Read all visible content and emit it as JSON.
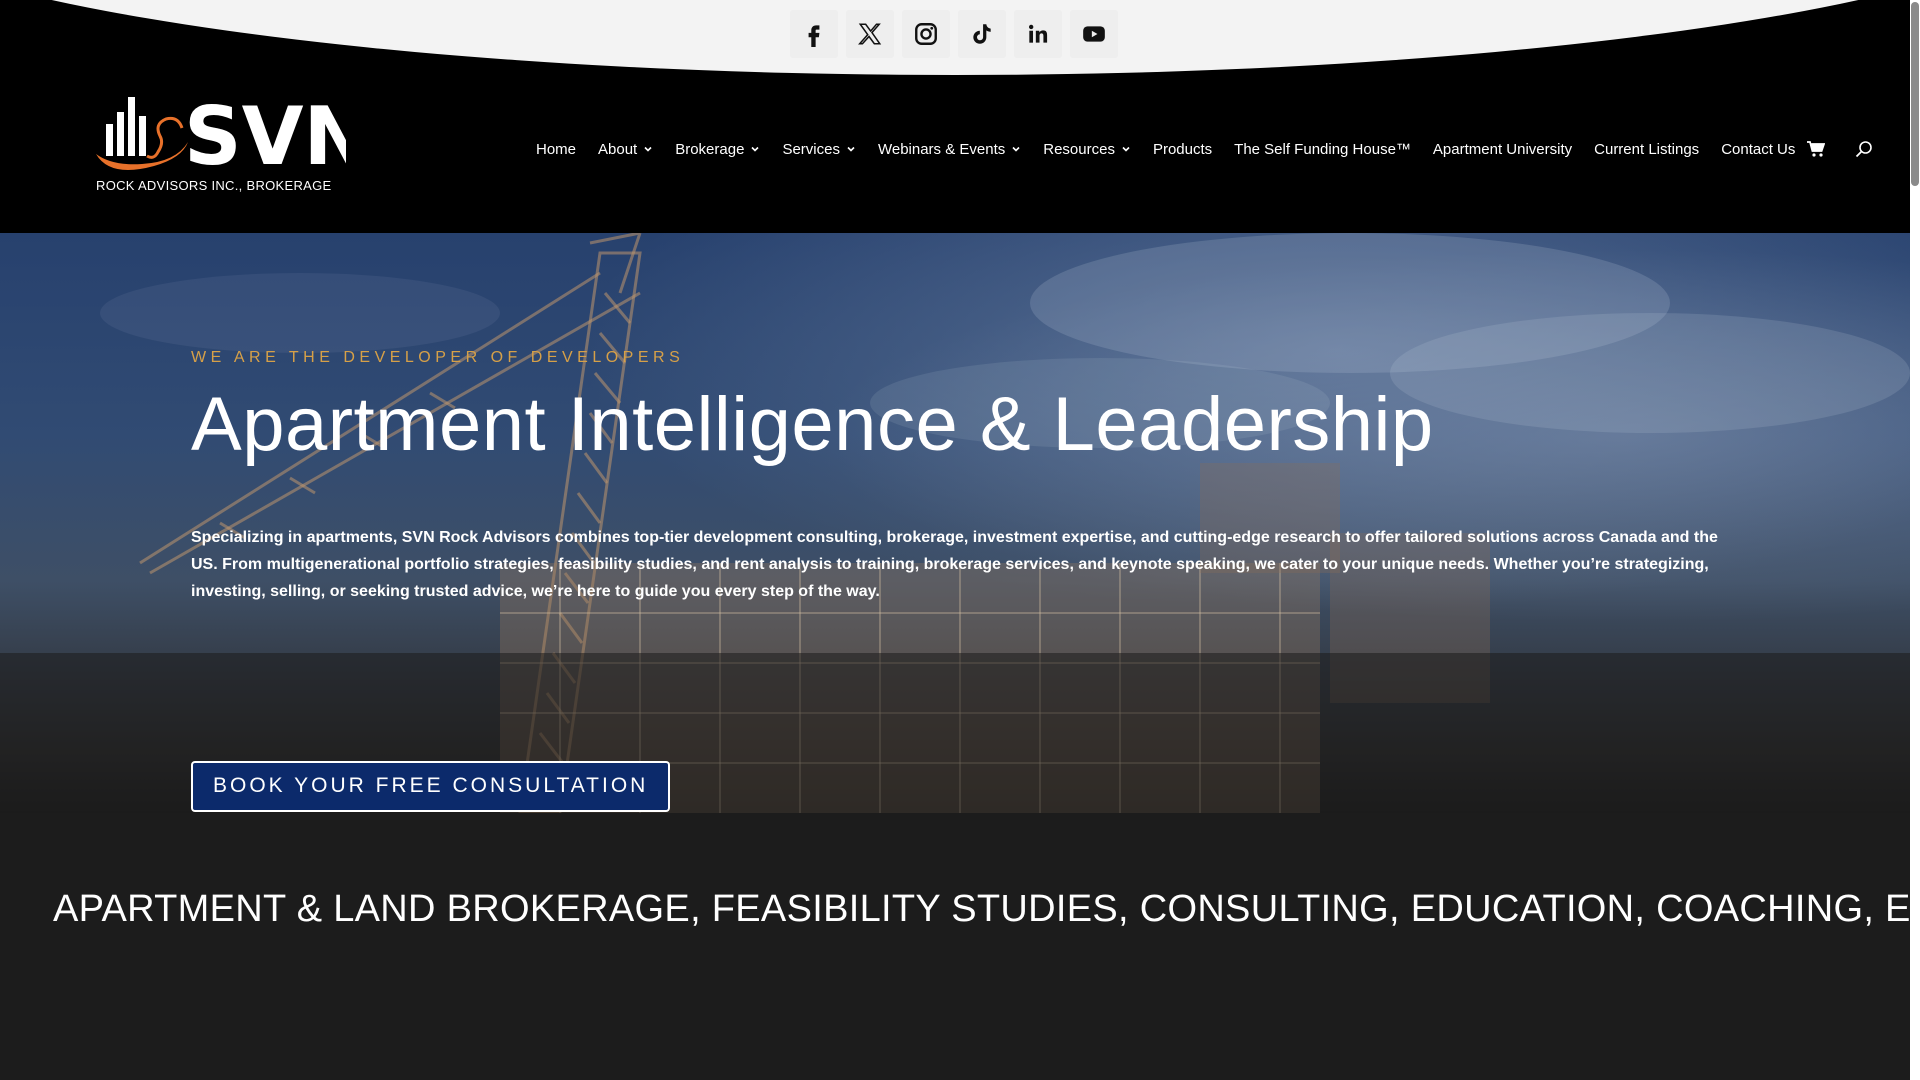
{
  "social": [
    {
      "name": "facebook-icon"
    },
    {
      "name": "x-twitter-icon"
    },
    {
      "name": "instagram-icon"
    },
    {
      "name": "tiktok-icon"
    },
    {
      "name": "linkedin-icon"
    },
    {
      "name": "youtube-icon"
    }
  ],
  "logo": {
    "wordmark": "SVN",
    "tagline": "ROCK ADVISORS INC., BROKERAGE",
    "accent_color": "#e8712a"
  },
  "nav": {
    "home": "Home",
    "about": "About",
    "brokerage": "Brokerage",
    "services": "Services",
    "webinars": "Webinars & Events",
    "resources": "Resources",
    "products": "Products",
    "self_funding": "The Self Funding House™",
    "apartment_university": "Apartment University",
    "current_listings": "Current Listings",
    "contact": "Contact Us",
    "cart_icon": "cart-icon",
    "search_icon": "search-icon"
  },
  "hero": {
    "eyebrow": "WE ARE THE DEVELOPER OF DEVELOPERS",
    "title": "Apartment Intelligence & Leadership",
    "description": "Specializing in apartments, SVN Rock Advisors combines top-tier development consulting, brokerage,  investment expertise, and cutting-edge research to offer tailored solutions across Canada and the US. From multigenerational portfolio strategies, feasibility studies, and rent analysis to training, brokerage services, and keynote speaking, we cater to your unique needs. Whether you’re strategizing, investing, selling, or seeking trusted advice, we’re here to guide you every step of the way.",
    "cta": "BOOK YOUR FREE CONSULTATION",
    "eyebrow_color": "#d6a048",
    "cta_color": "#0c2a6b"
  },
  "ticker": {
    "text": "APARTMENT & LAND BROKERAGE, FEASIBILITY STUDIES, CONSULTING, EDUCATION, COACHING, EVE"
  }
}
